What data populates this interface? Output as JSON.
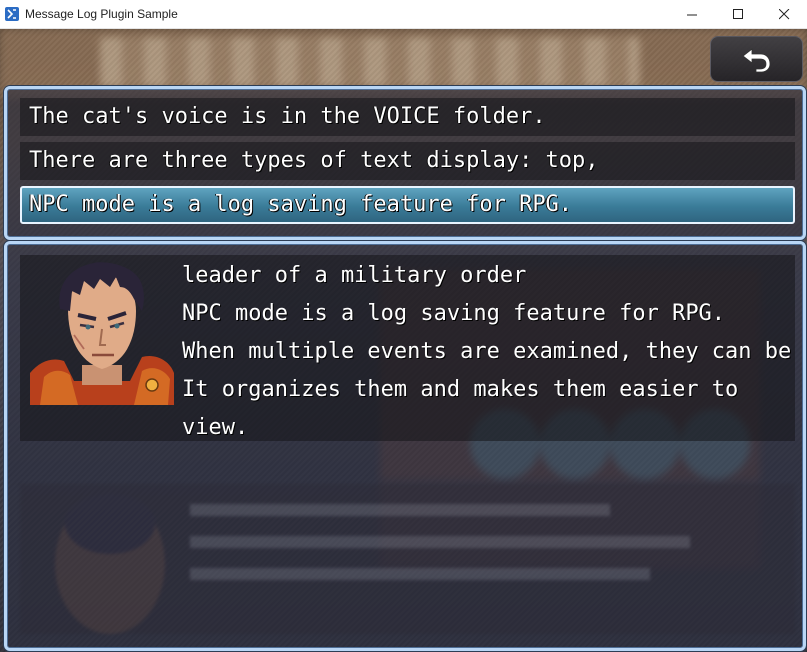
{
  "window": {
    "title": "Message Log Plugin Sample",
    "minimize_glyph": "—",
    "maximize_glyph": "☐",
    "close_glyph": "✕"
  },
  "back_button": {
    "icon": "return-arrow-icon"
  },
  "log_list": {
    "items": [
      {
        "text": "The cat's voice is in the VOICE folder.",
        "selected": false
      },
      {
        "text": "There are three types of text display: top,",
        "selected": false
      },
      {
        "text": "NPC mode is a log saving feature for RPG.",
        "selected": true
      }
    ]
  },
  "message": {
    "face": "military-leader-face",
    "lines": [
      "leader of a military order",
      "NPC mode is a log saving feature for RPG.",
      "When multiple events are examined, they can be",
      "It organizes them and makes them easier to",
      "view."
    ]
  },
  "colors": {
    "window_border": "#b9d6f5",
    "selected_item": "#3a7b98",
    "text": "#ffffff"
  }
}
